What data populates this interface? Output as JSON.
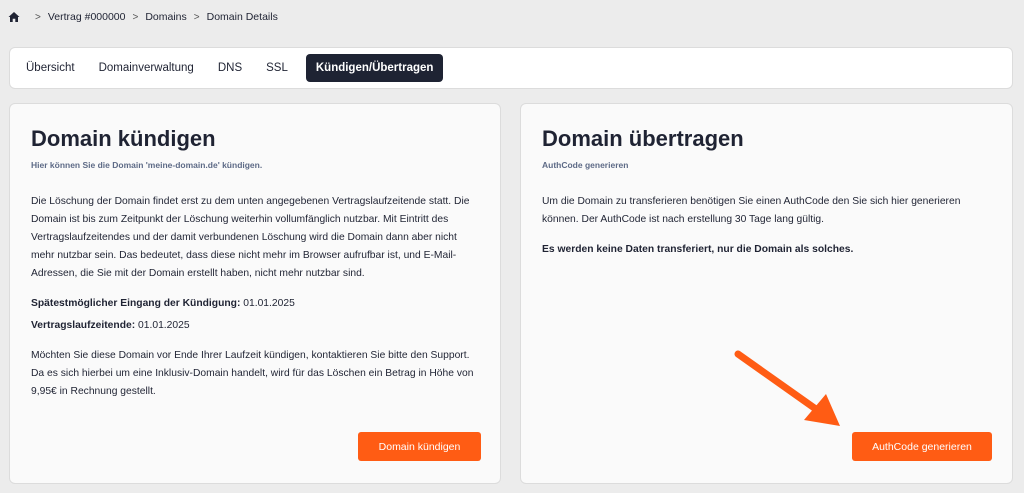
{
  "breadcrumb": {
    "items": [
      "Vertrag #000000",
      "Domains",
      "Domain Details"
    ]
  },
  "tabs": [
    {
      "label": "Übersicht",
      "active": false
    },
    {
      "label": "Domainverwaltung",
      "active": false
    },
    {
      "label": "DNS",
      "active": false
    },
    {
      "label": "SSL",
      "active": false
    },
    {
      "label": "Kündigen/Übertragen",
      "active": true
    }
  ],
  "cancel_card": {
    "title": "Domain kündigen",
    "subtitle": "Hier können Sie die Domain 'meine-domain.de' kündigen.",
    "paragraph1": "Die Löschung der Domain findet erst zu dem unten angegebenen Vertragslaufzeitende statt. Die Domain ist bis zum Zeitpunkt der Löschung weiterhin vollumfänglich nutzbar. Mit Eintritt des Vertragslaufzeitendes und der damit verbundenen Löschung wird die Domain dann aber nicht mehr nutzbar sein. Das bedeutet, dass diese nicht mehr im Browser aufrufbar ist, und E-Mail-Adressen, die Sie mit der Domain erstellt haben, nicht mehr nutzbar sind.",
    "deadline_label": "Spätestmöglicher Eingang der Kündigung:",
    "deadline_value": "01.01.2025",
    "contract_end_label": "Vertragslaufzeitende:",
    "contract_end_value": "01.01.2025",
    "paragraph2": "Möchten Sie diese Domain vor Ende Ihrer Laufzeit kündigen, kontaktieren Sie bitte den Support. Da es sich hierbei um eine Inklusiv-Domain handelt, wird für das Löschen ein Betrag in Höhe von 9,95€ in Rechnung gestellt.",
    "button_label": "Domain kündigen"
  },
  "transfer_card": {
    "title": "Domain übertragen",
    "subtitle": "AuthCode generieren",
    "paragraph1": "Um die Domain zu transferieren benötigen Sie einen AuthCode den Sie sich hier generieren können. Der AuthCode ist nach erstellung 30 Tage lang gültig.",
    "paragraph2": "Es werden keine Daten transferiert, nur die Domain als solches.",
    "button_label": "AuthCode generieren"
  },
  "colors": {
    "accent": "#ff5c14",
    "nav_active": "#1e2333",
    "subtitle": "#5d6a86",
    "annotation_arrow": "#ff5c14"
  },
  "icons": [
    "home-icon",
    "chevron-right-icon",
    "arrow-annotation"
  ]
}
